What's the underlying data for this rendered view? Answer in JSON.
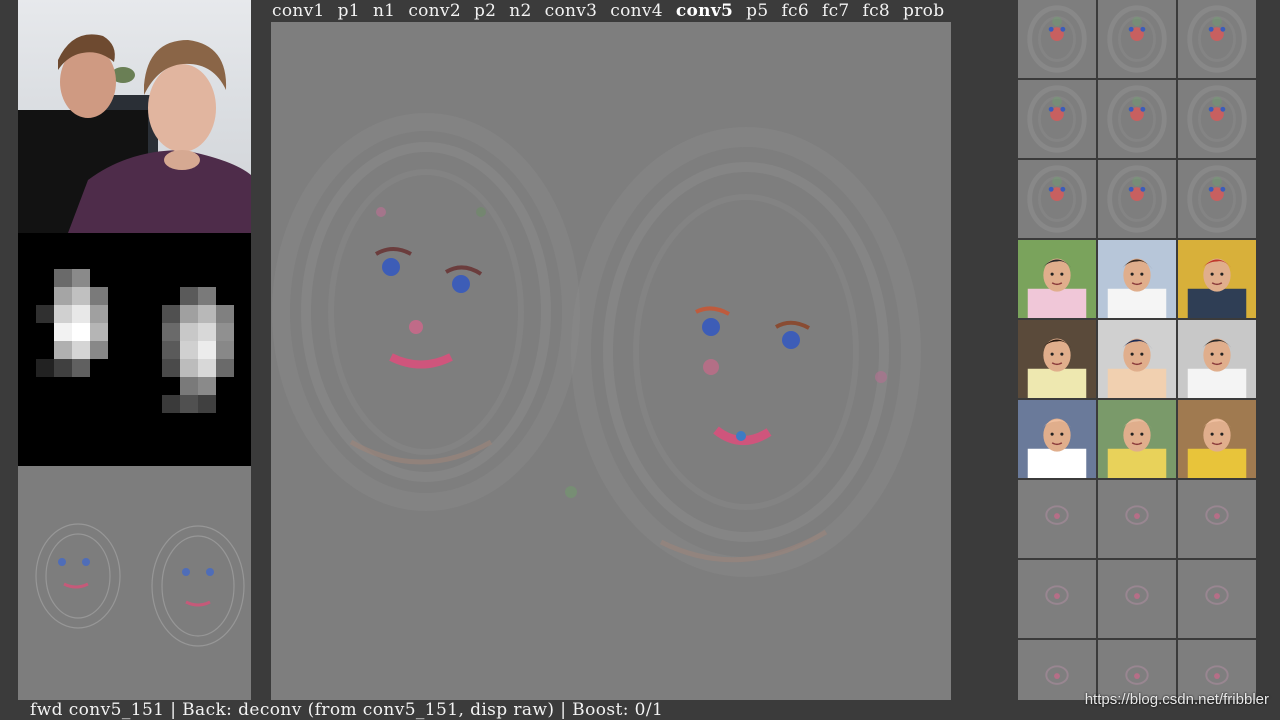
{
  "layers": {
    "tabs": [
      "conv1",
      "p1",
      "n1",
      "conv2",
      "p2",
      "n2",
      "conv3",
      "conv4",
      "conv5",
      "p5",
      "fc6",
      "fc7",
      "fc8",
      "prob"
    ],
    "active": "conv5"
  },
  "status": {
    "text": "fwd conv5_151 | Back: deconv (from conv5_151, disp raw) | Boost: 0/1"
  },
  "watermark": "https://blog.csdn.net/fribbler",
  "colors": {
    "background": "#3b3b3b",
    "panel_gray": "#7e7e7e",
    "text": "#f2f2f2"
  },
  "grid": {
    "columns": 3,
    "rows": [
      {
        "kind": "deconv-face-large",
        "cells": 3
      },
      {
        "kind": "deconv-face-large",
        "cells": 3
      },
      {
        "kind": "deconv-face-large",
        "cells": 3
      },
      {
        "kind": "photo",
        "cells": 3
      },
      {
        "kind": "photo",
        "cells": 3
      },
      {
        "kind": "photo",
        "cells": 3
      },
      {
        "kind": "deconv-face-small",
        "cells": 3
      },
      {
        "kind": "deconv-face-small",
        "cells": 3
      },
      {
        "kind": "deconv-face-small",
        "cells": 3
      }
    ]
  }
}
